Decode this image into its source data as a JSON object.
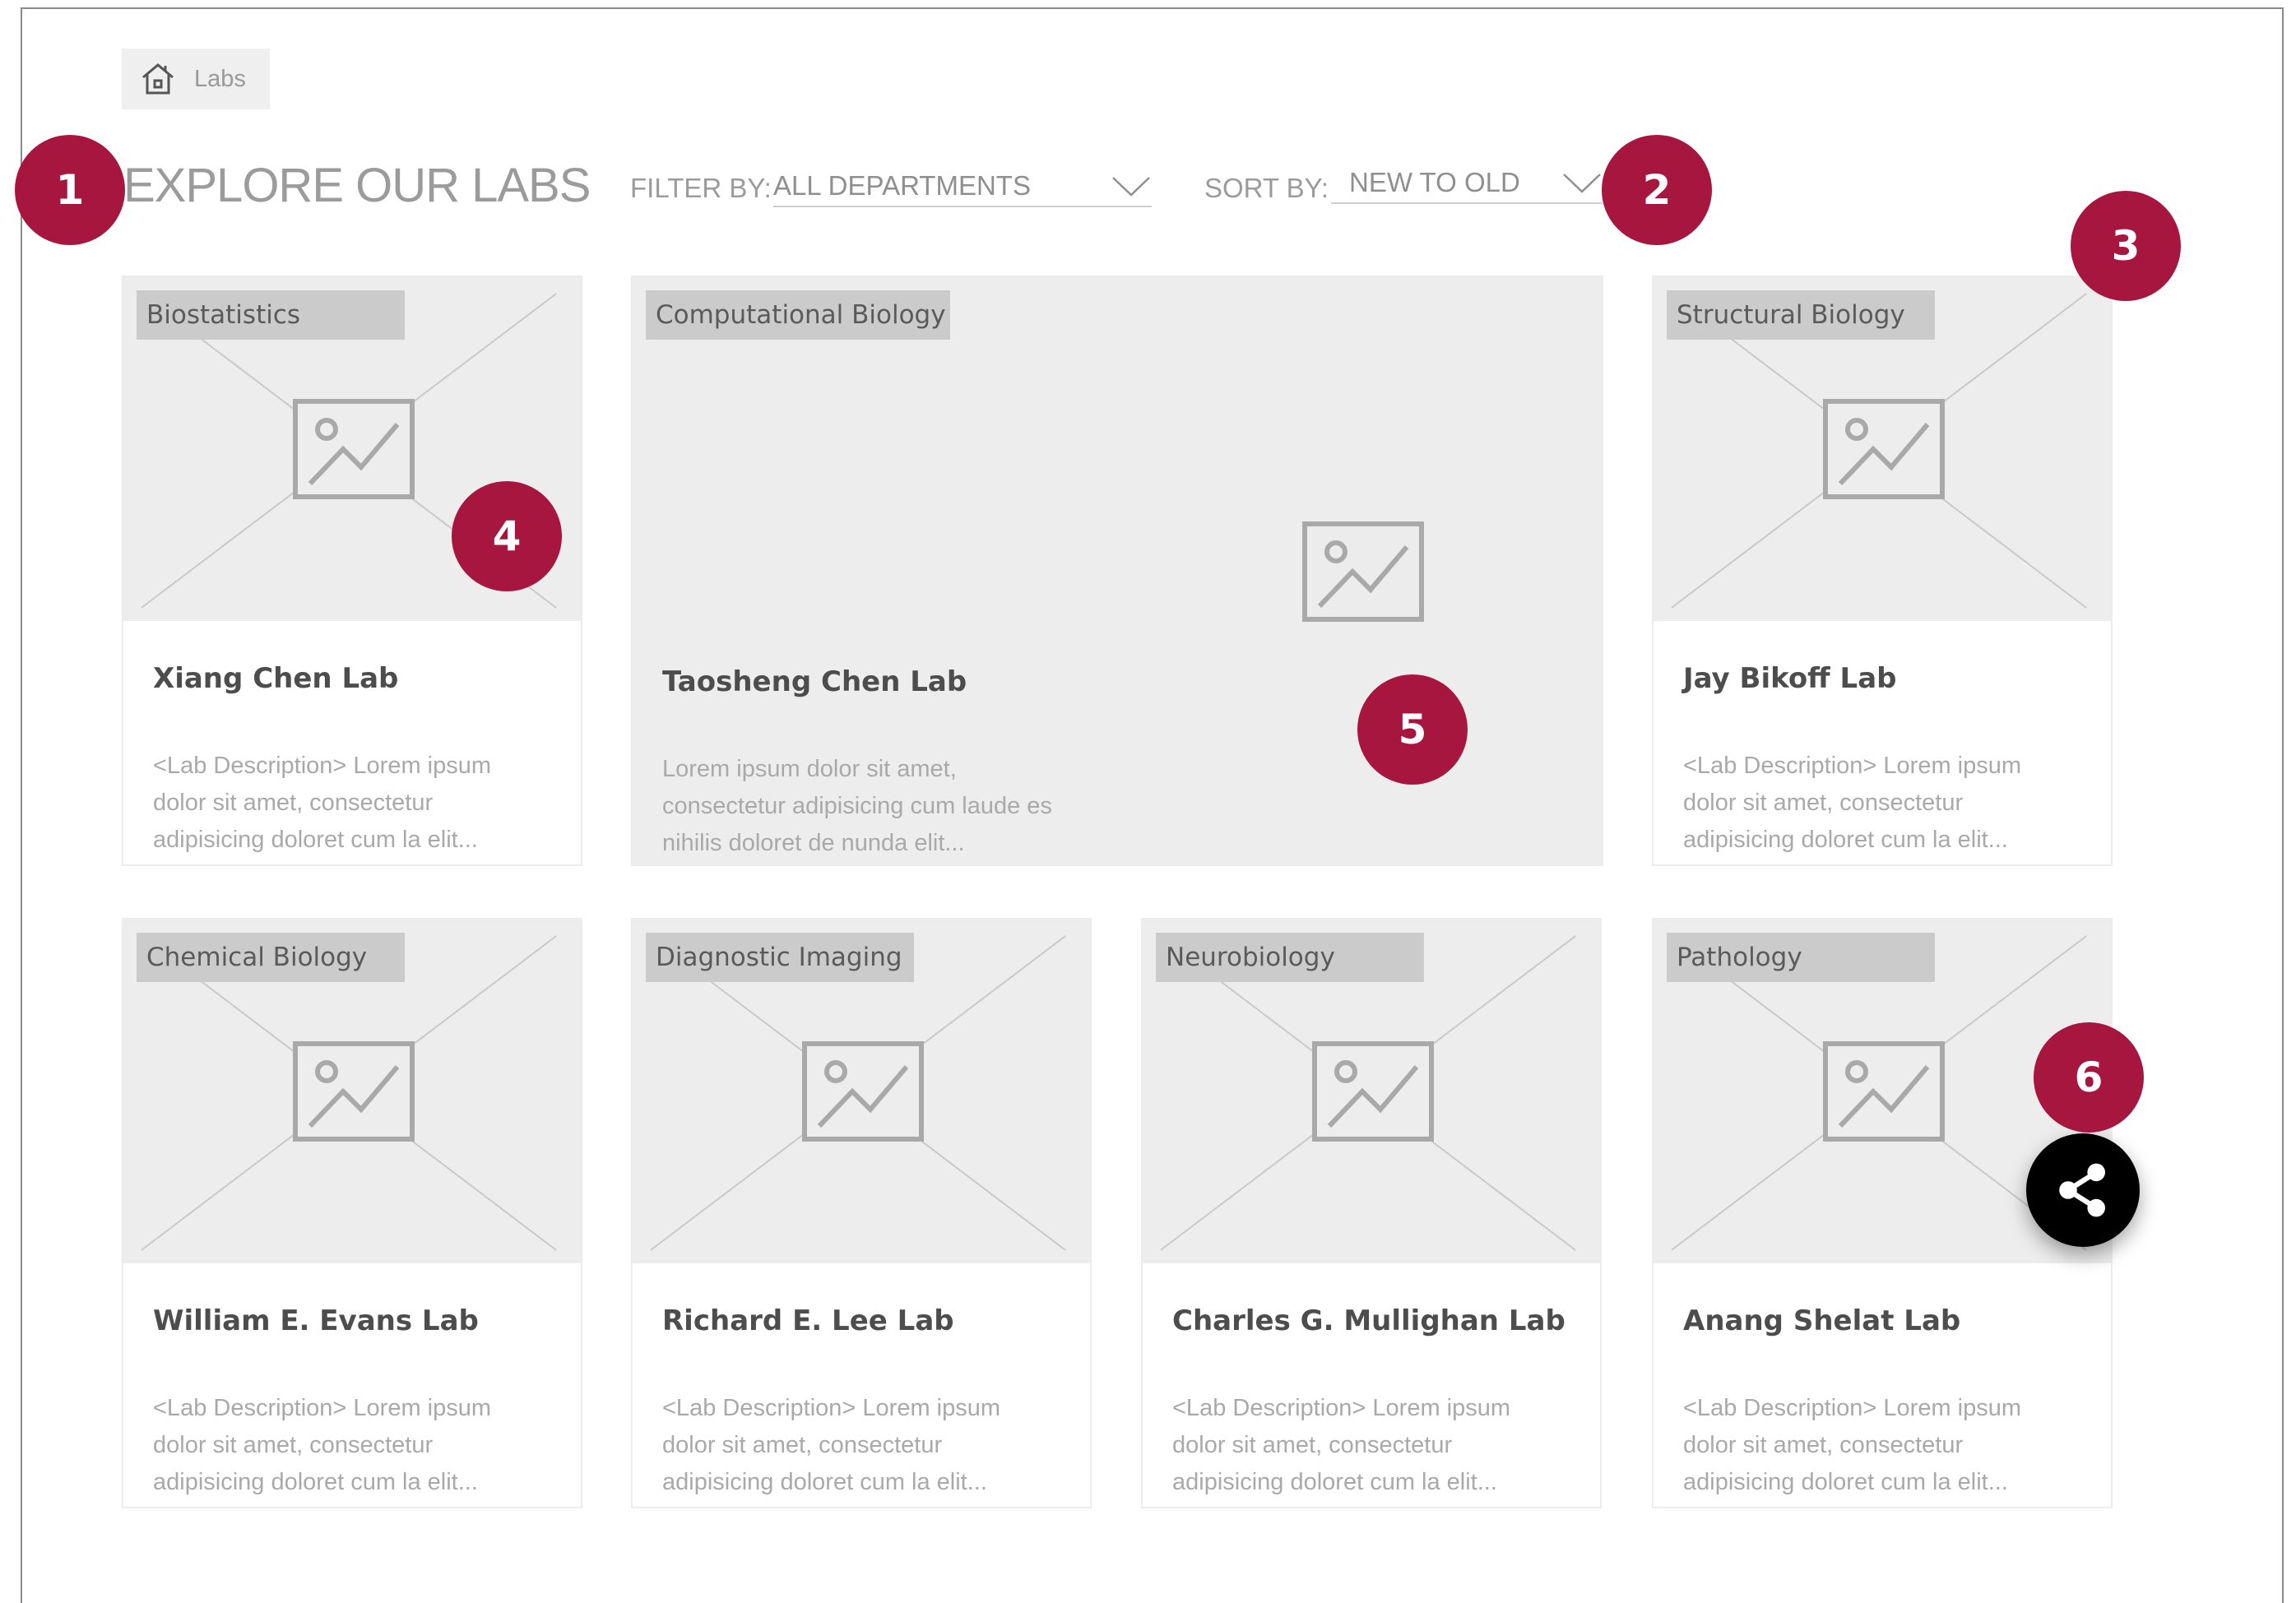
{
  "breadcrumb": {
    "label": "Labs"
  },
  "header": {
    "title": "EXPLORE OUR LABS",
    "filter_label": "FILTER BY:",
    "filter_value": "ALL DEPARTMENTS",
    "sort_label": "SORT BY:",
    "sort_value": "NEW TO OLD"
  },
  "labs": [
    {
      "department": "Biostatistics",
      "name": "Xiang Chen Lab",
      "description": "<Lab Description> Lorem ipsum dolor sit amet, consectetur adipisicing doloret cum la elit..."
    },
    {
      "department": "Computational Biology",
      "name": "Taosheng Chen Lab",
      "description": "Lorem ipsum dolor sit amet, consectetur adipisicing cum laude es nihilis doloret de nunda  elit..."
    },
    {
      "department": "Structural Biology",
      "name": "Jay Bikoff Lab",
      "description": "<Lab Description> Lorem ipsum dolor sit amet, consectetur adipisicing doloret cum la elit..."
    },
    {
      "department": "Chemical Biology",
      "name": "William E. Evans Lab",
      "description": "<Lab Description> Lorem ipsum dolor sit amet, consectetur adipisicing doloret cum la elit..."
    },
    {
      "department": "Diagnostic Imaging",
      "name": "Richard E. Lee Lab",
      "description": "<Lab Description> Lorem ipsum dolor sit amet, consectetur adipisicing doloret cum la elit..."
    },
    {
      "department": "Neurobiology",
      "name": "Charles G. Mullighan Lab",
      "description": "<Lab Description> Lorem ipsum dolor sit amet, consectetur adipisicing doloret cum la elit..."
    },
    {
      "department": "Pathology",
      "name": "Anang Shelat Lab",
      "description": "<Lab Description> Lorem ipsum dolor sit amet, consectetur adipisicing doloret cum la elit..."
    }
  ],
  "annotations": [
    "1",
    "2",
    "3",
    "4",
    "5",
    "6"
  ],
  "icons": {
    "home": "home-icon",
    "chevron": "chevron-down-icon",
    "image": "image-placeholder-icon",
    "share": "share-icon"
  },
  "colors": {
    "badge": "#a6163f",
    "tag": "#cbcbcb",
    "media": "#ededed",
    "fab": "#000000"
  }
}
